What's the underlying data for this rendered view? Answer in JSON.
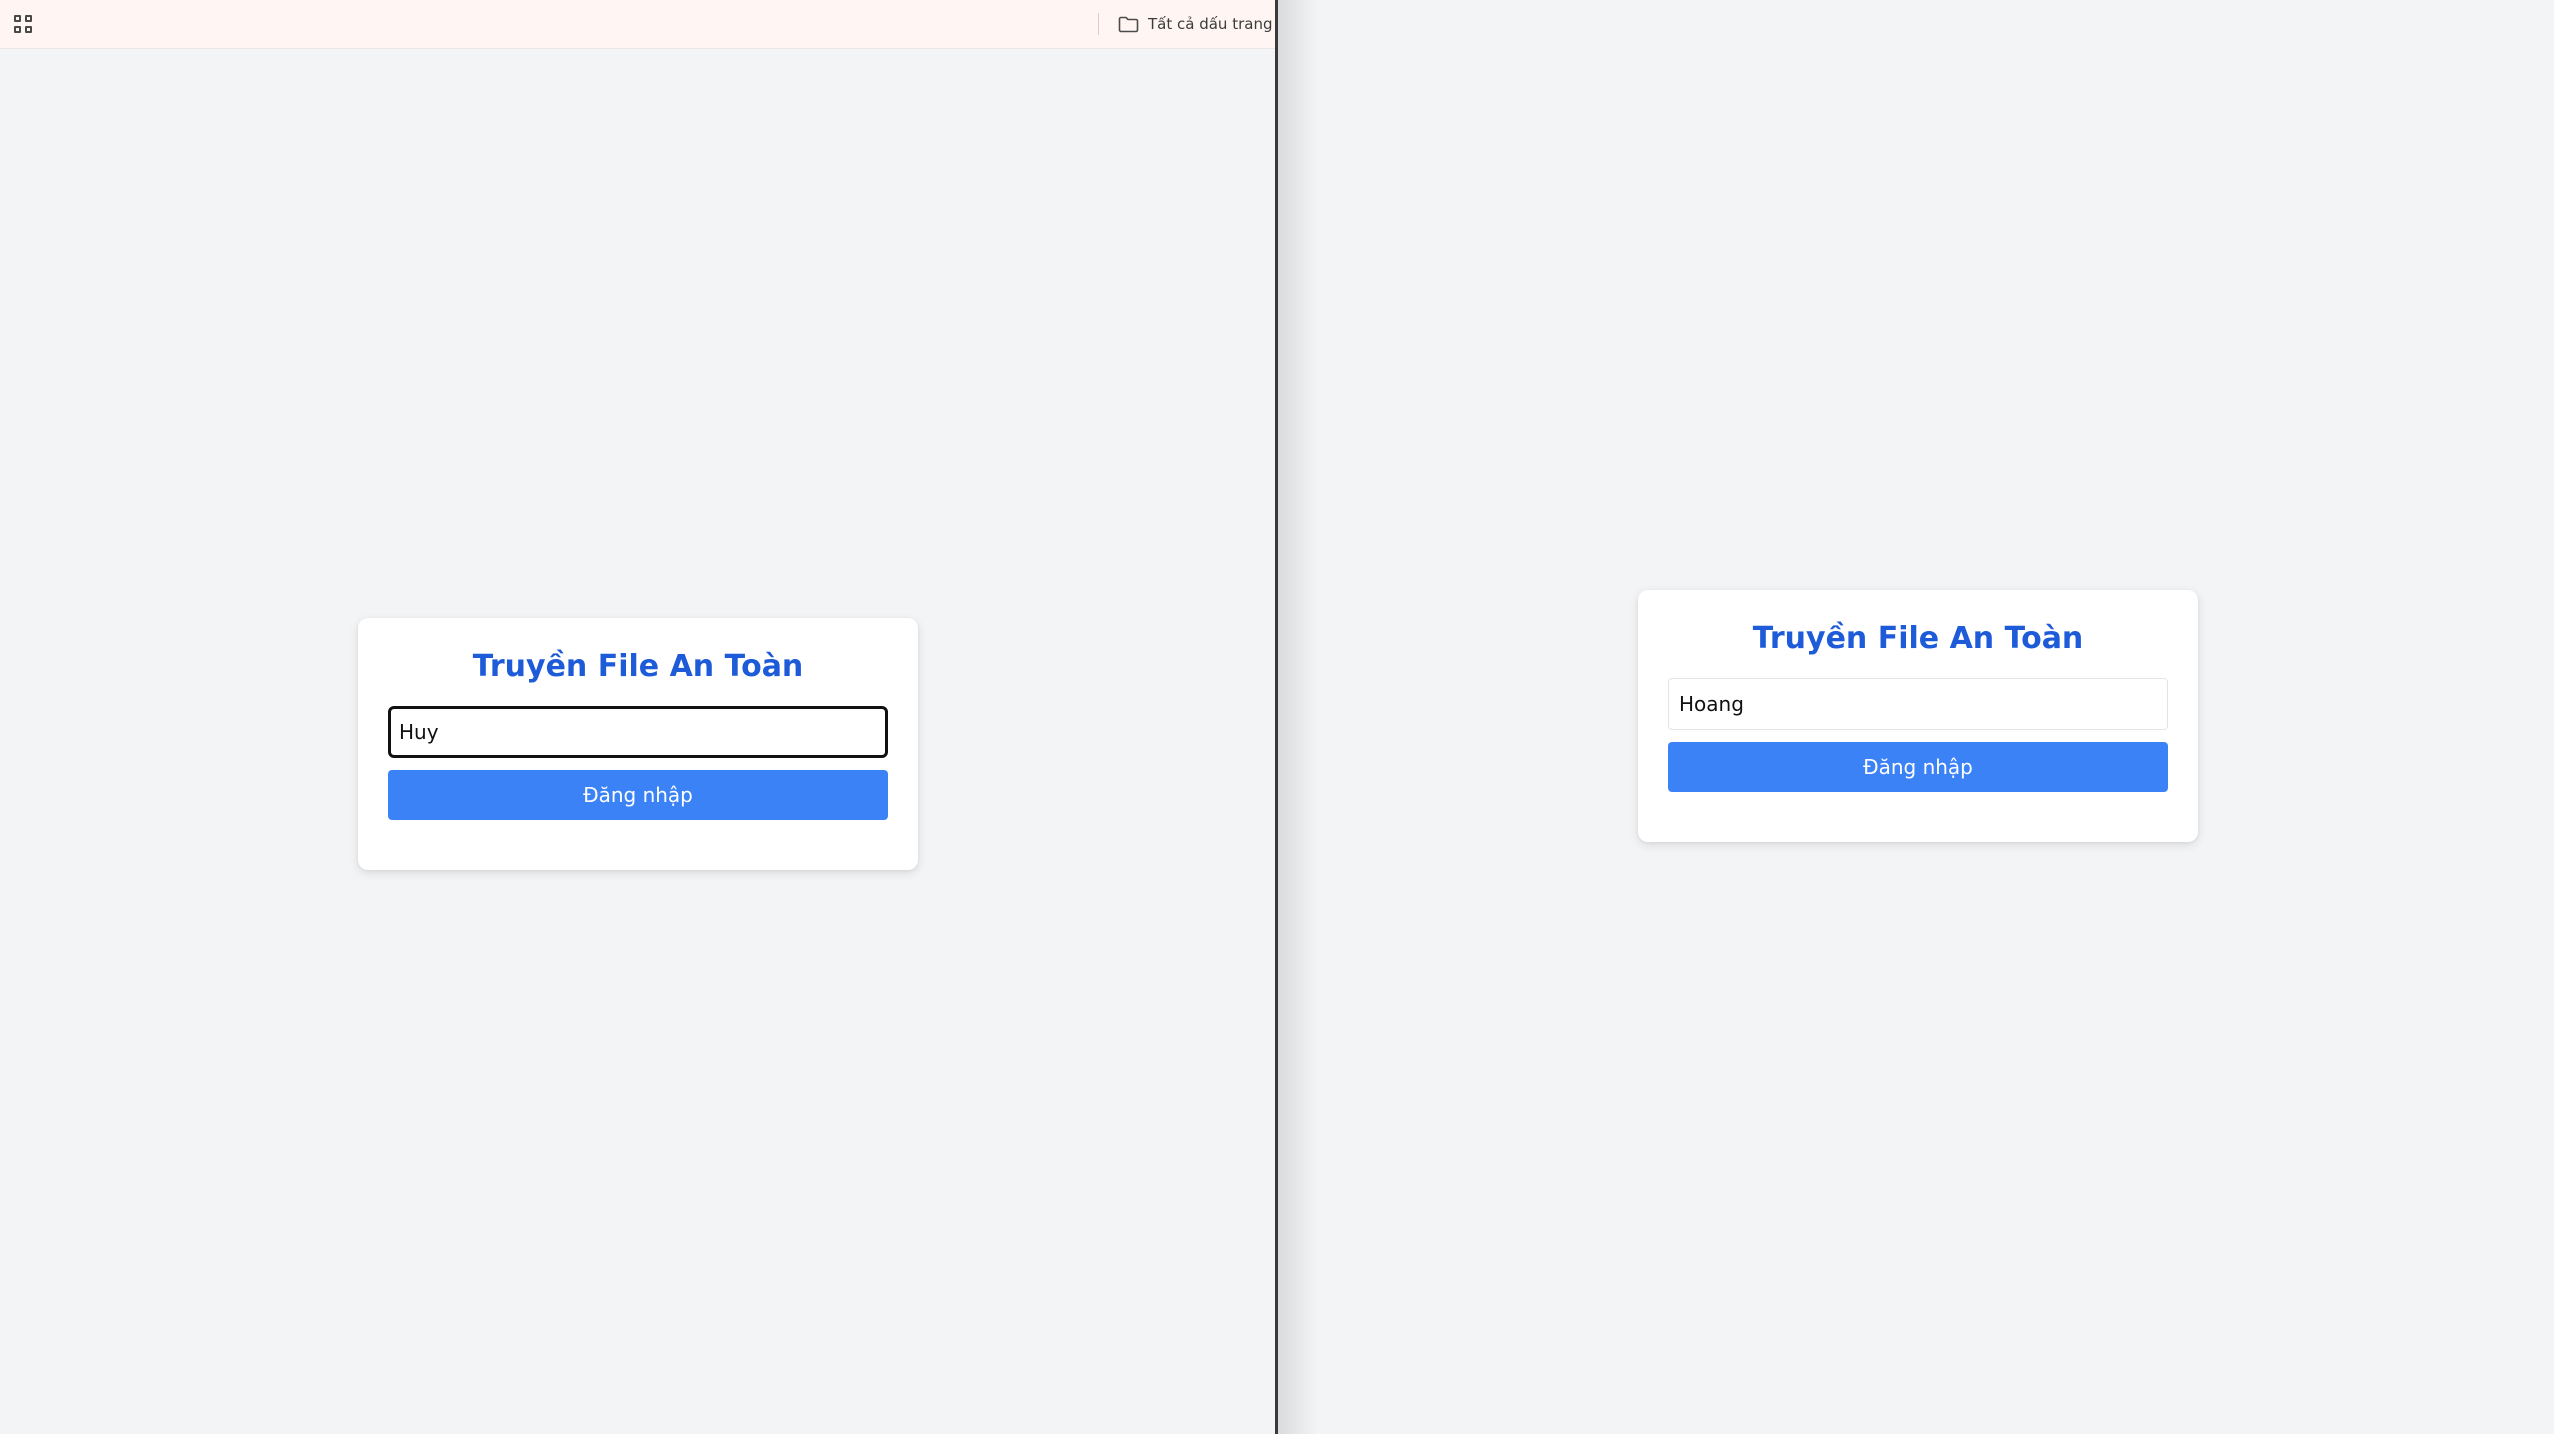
{
  "left_window": {
    "bookmarks_bar": {
      "apps_icon": "apps-grid-icon",
      "all_bookmarks_icon": "folder-icon",
      "all_bookmarks_label": "Tất cả dấu trang"
    },
    "login": {
      "title": "Truyền File An Toàn",
      "username_value": "Huy",
      "login_label": "Đăng nhập"
    }
  },
  "right_window": {
    "login": {
      "title": "Truyền File An Toàn",
      "username_value": "Hoang",
      "login_label": "Đăng nhập"
    }
  },
  "colors": {
    "page_background": "#f3f4f6",
    "title": "#1d5bd8",
    "button": "#3b82f6",
    "bookmarks_bar": "#fff6f4"
  }
}
